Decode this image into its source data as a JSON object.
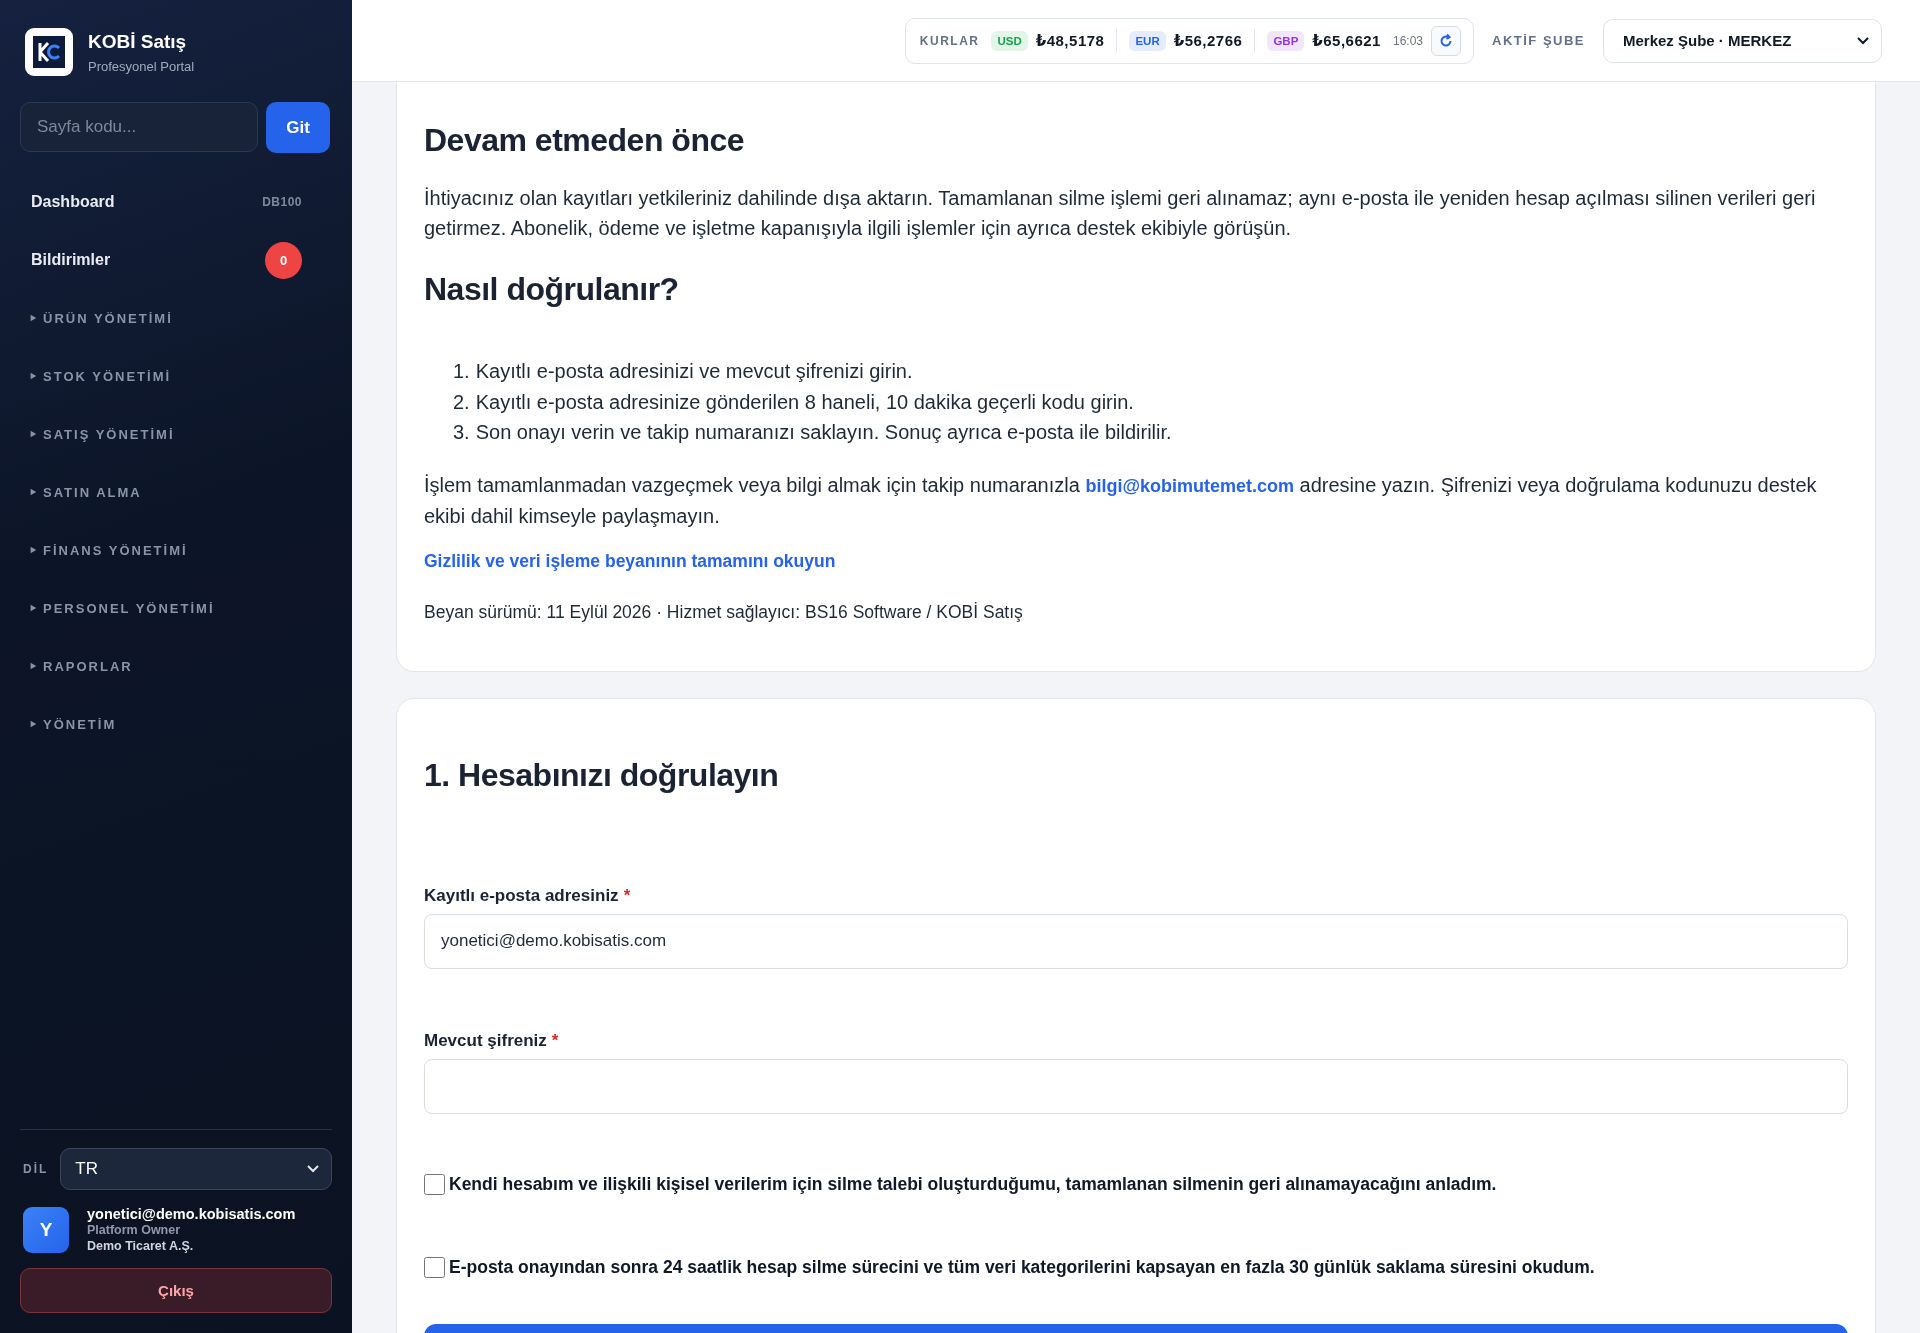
{
  "sidebar": {
    "brand": {
      "title": "KOBİ Satış",
      "subtitle": "Profesyonel Portal"
    },
    "page_code": {
      "placeholder": "Sayfa kodu...",
      "button": "Git"
    },
    "links": [
      {
        "label": "Dashboard",
        "code": "DB100"
      },
      {
        "label": "Bildirimler",
        "badge": "0"
      }
    ],
    "groups": [
      {
        "label": "ÜRÜN YÖNETİMİ",
        "expanded": false
      },
      {
        "label": "STOK YÖNETİMİ",
        "expanded": false
      },
      {
        "label": "SATIŞ YÖNETİMİ",
        "expanded": false
      },
      {
        "label": "SATIN ALMA",
        "expanded": false
      },
      {
        "label": "FİNANS YÖNETİMİ",
        "expanded": false
      },
      {
        "label": "PERSONEL YÖNETİMİ",
        "expanded": false
      },
      {
        "label": "RAPORLAR",
        "expanded": false
      },
      {
        "label": "YÖNETİM",
        "expanded": false
      }
    ],
    "language": {
      "label": "DİL",
      "value": "TR"
    },
    "user": {
      "initial": "Y",
      "email": "yonetici@demo.kobisatis.com",
      "role": "Platform Owner",
      "company": "Demo Ticaret A.Ş."
    },
    "logout": "Çıkış"
  },
  "topbar": {
    "rates_label": "KURLAR",
    "rates": [
      {
        "code": "USD",
        "value": "₺48,5178",
        "color": "#16a34a"
      },
      {
        "code": "EUR",
        "value": "₺56,2766",
        "color": "#2563eb"
      },
      {
        "code": "GBP",
        "value": "₺65,6621",
        "color": "#9333ea"
      }
    ],
    "time": "16:03",
    "branch_label": "AKTİF ŞUBE",
    "branch": "Merkez Şube · MERKEZ"
  },
  "info_card": {
    "sections": [
      {
        "heading": "Devam etmeden önce",
        "paragraphs": [
          "İhtiyacınız olan kayıtları yetkileriniz dahilinde dışa aktarın. Tamamlanan silme işlemi geri alınamaz; aynı e-posta ile yeniden hesap açılması silinen verileri geri getirmez. Abonelik, ödeme ve işletme kapanışıyla ilgili işlemler için ayrıca destek ekibiyle görüşün."
        ]
      },
      {
        "heading": "Nasıl doğrulanır?",
        "steps": [
          {
            "number": "1.",
            "text": "Kayıtlı e-posta adresinizi ve mevcut şifrenizi girin."
          },
          {
            "number": "2.",
            "text": "Kayıtlı e-posta adresinize gönderilen 8 haneli, 10 dakika geçerli kodu girin."
          },
          {
            "number": "3.",
            "text": "Son onayı verin ve takip numaranızı saklayın. Sonuç ayrıca e-posta ile bildirilir."
          }
        ]
      }
    ],
    "contact": {
      "before": "İşlem tamamlanmadan vazgeçmek veya bilgi almak için takip numaranızla",
      "email": "bilgi@kobimutemet.com",
      "after": "adresine yazın. Şifrenizi veya doğrulama kodunuzu destek ekibi dahil kimseyle paylaşmayın."
    },
    "policy_link": "Gizlilik ve veri işleme beyanının tamamını okuyun",
    "version": "Beyan sürümü: 11 Eylül 2026 · Hizmet sağlayıcı: BS16 Software / KOBİ Satış"
  },
  "form_card": {
    "title": "1. Hesabınızı doğrulayın",
    "fields": [
      {
        "label": "Kayıtlı e-posta adresiniz",
        "required_mark": "*",
        "value": "yonetici@demo.kobisatis.com"
      },
      {
        "label": "Mevcut şifreniz",
        "required_mark": "*"
      }
    ],
    "checks": [
      {
        "label": "Kendi hesabım ve ilişkili kişisel verilerim için silme talebi oluşturduğumu, tamamlanan silmenin geri alınamayacağını anladım.",
        "checked": false
      },
      {
        "label": "E-posta onayından sonra 24 saatlik hesap silme sürecini ve tüm veri kategorilerini kapsayan en fazla 30 günlük saklama süresini okudum.",
        "checked": false
      }
    ]
  }
}
